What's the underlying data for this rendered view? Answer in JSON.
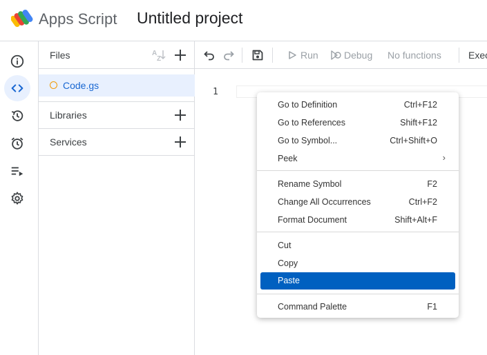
{
  "header": {
    "app_name": "Apps Script",
    "project_title": "Untitled project"
  },
  "rail": {
    "items": [
      {
        "icon": "info-icon",
        "label": "Overview"
      },
      {
        "icon": "code-icon",
        "label": "Editor",
        "active": true
      },
      {
        "icon": "history-icon",
        "label": "Executions"
      },
      {
        "icon": "alarm-icon",
        "label": "Triggers"
      },
      {
        "icon": "executions-list-icon",
        "label": "Executions list"
      },
      {
        "icon": "gear-icon",
        "label": "Project Settings"
      }
    ]
  },
  "files_panel": {
    "files_title": "Files",
    "files": [
      {
        "name": "Code.gs"
      }
    ],
    "libraries_title": "Libraries",
    "services_title": "Services"
  },
  "toolbar": {
    "run_label": "Run",
    "debug_label": "Debug",
    "function_select": "No functions",
    "overflow_label": "Exec"
  },
  "editor": {
    "line_numbers": [
      "1"
    ]
  },
  "context_menu": {
    "groups": [
      [
        {
          "label": "Go to Definition",
          "shortcut": "Ctrl+F12"
        },
        {
          "label": "Go to References",
          "shortcut": "Shift+F12"
        },
        {
          "label": "Go to Symbol...",
          "shortcut": "Ctrl+Shift+O"
        },
        {
          "label": "Peek",
          "shortcut": ""
        }
      ],
      [
        {
          "label": "Rename Symbol",
          "shortcut": "F2"
        },
        {
          "label": "Change All Occurrences",
          "shortcut": "Ctrl+F2"
        },
        {
          "label": "Format Document",
          "shortcut": "Shift+Alt+F"
        }
      ],
      [
        {
          "label": "Cut",
          "shortcut": ""
        },
        {
          "label": "Copy",
          "shortcut": ""
        },
        {
          "label": "Paste",
          "shortcut": ""
        }
      ],
      [
        {
          "label": "Command Palette",
          "shortcut": "F1"
        }
      ]
    ],
    "highlighted": "Paste"
  },
  "colors": {
    "accent": "#1967d2",
    "active_bg": "#e8f0fe",
    "menu_highlight": "#0060c0",
    "file_dot": "#f29900"
  }
}
